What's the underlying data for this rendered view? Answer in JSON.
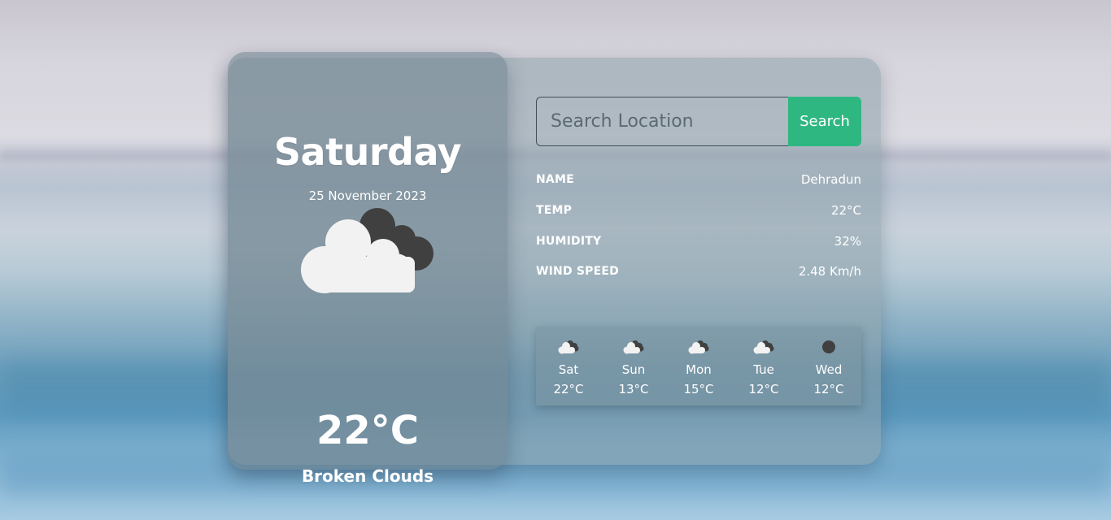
{
  "current": {
    "day": "Saturday",
    "date": "25 November 2023",
    "temperature": "22°C",
    "description": "Broken Clouds",
    "icon": "broken-clouds-icon"
  },
  "search": {
    "placeholder": "Search Location",
    "value": "",
    "button_label": "Search"
  },
  "details": [
    {
      "label": "NAME",
      "value": "Dehradun"
    },
    {
      "label": "TEMP",
      "value": "22°C"
    },
    {
      "label": "HUMIDITY",
      "value": "32%"
    },
    {
      "label": "WIND SPEED",
      "value": "2.48 Km/h"
    }
  ],
  "forecast": [
    {
      "day": "Sat",
      "temp": "22°C",
      "icon": "broken-clouds-icon"
    },
    {
      "day": "Sun",
      "temp": "13°C",
      "icon": "broken-clouds-icon"
    },
    {
      "day": "Mon",
      "temp": "15°C",
      "icon": "broken-clouds-icon"
    },
    {
      "day": "Tue",
      "temp": "12°C",
      "icon": "broken-clouds-icon"
    },
    {
      "day": "Wed",
      "temp": "12°C",
      "icon": "overcast-icon"
    }
  ],
  "colors": {
    "accent": "#2fb782",
    "text": "#ffffff",
    "cloud_light": "#f2f2f2",
    "cloud_dark": "#404040"
  }
}
